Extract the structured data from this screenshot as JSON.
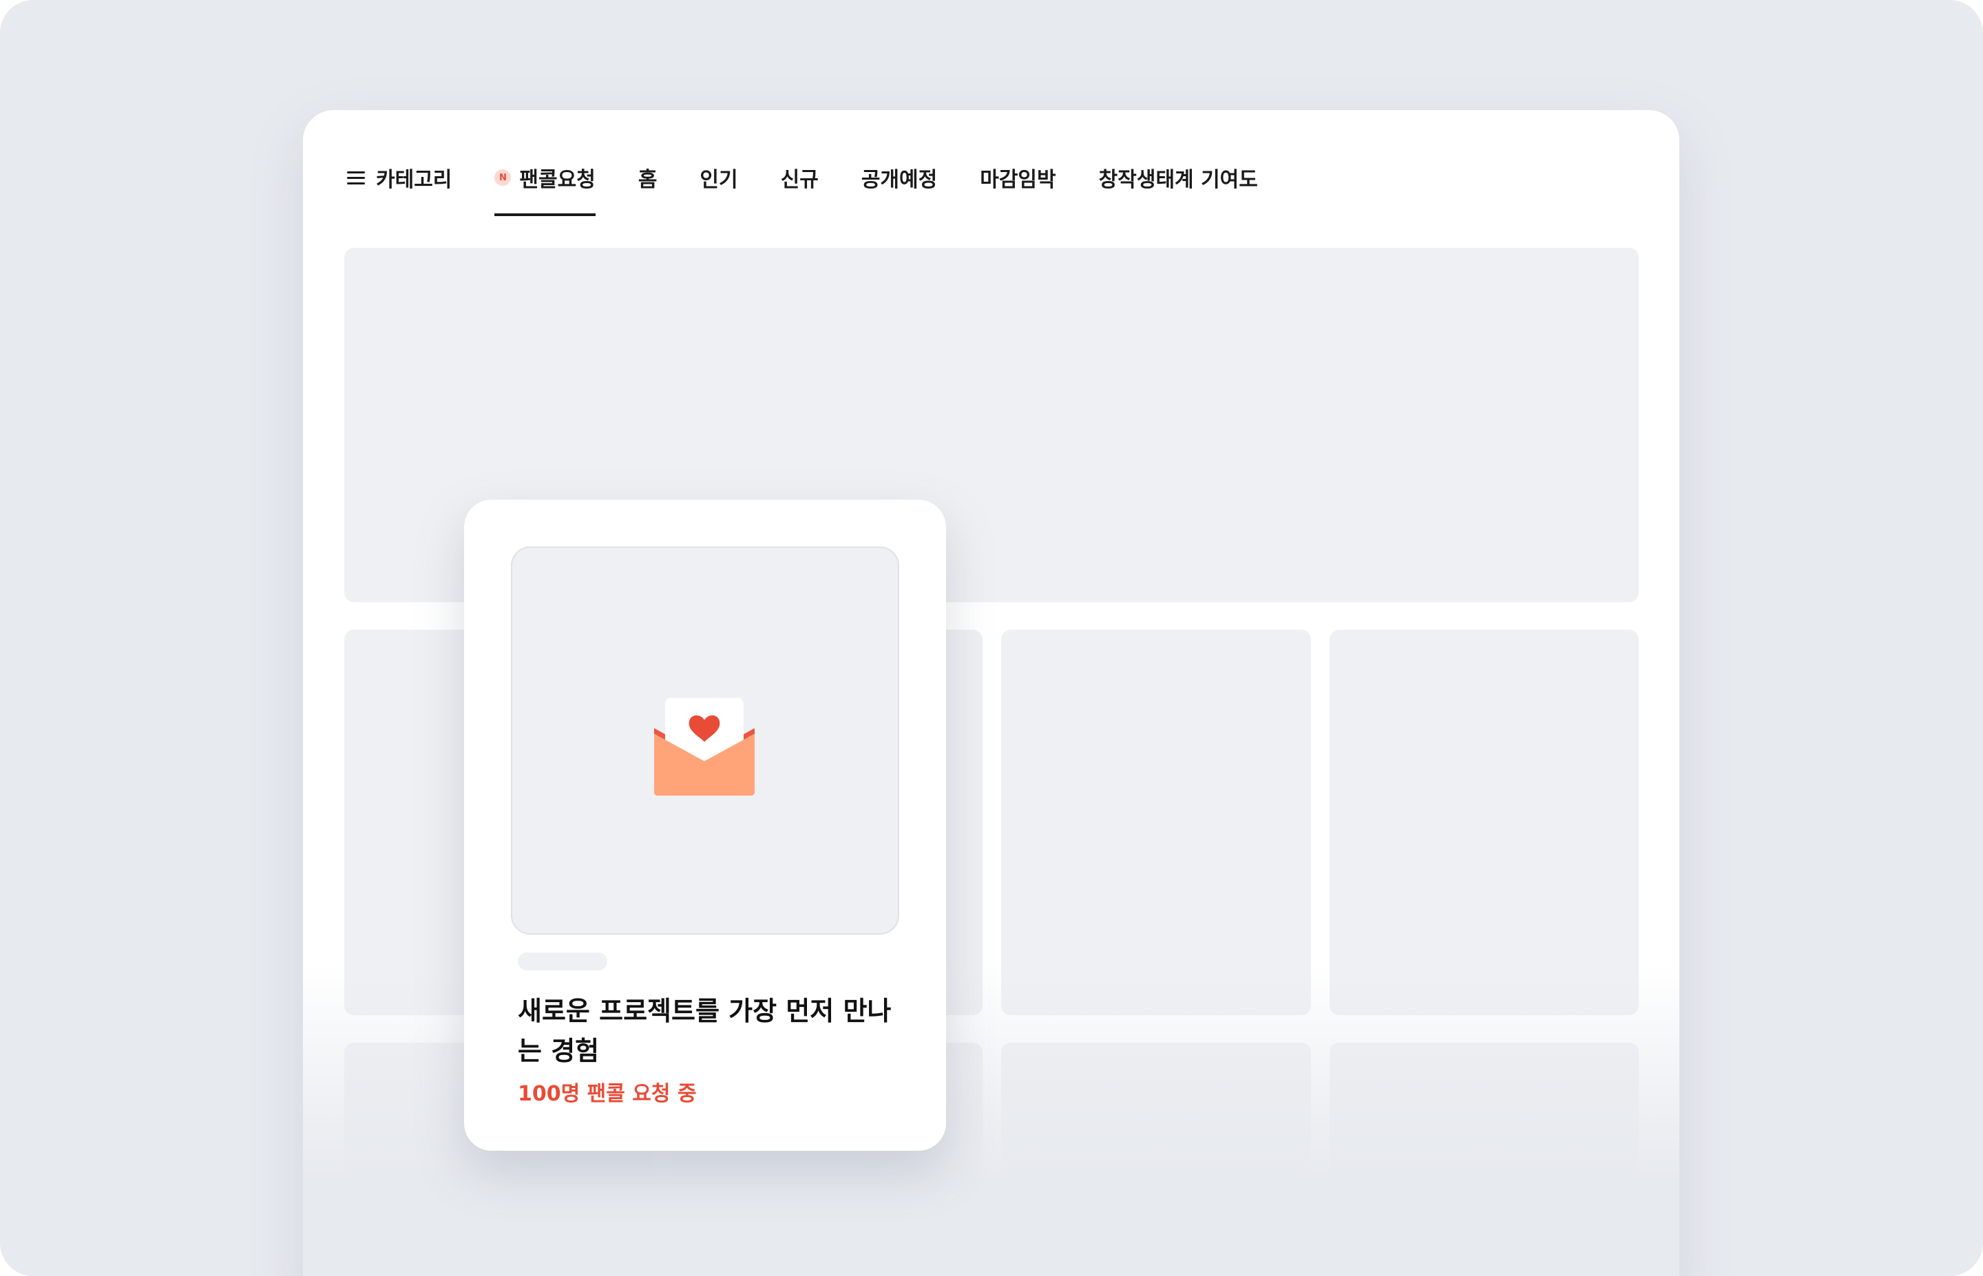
{
  "nav": {
    "items": [
      {
        "label": "카테고리"
      },
      {
        "label": "팬콜요청",
        "badge": "N"
      },
      {
        "label": "홈"
      },
      {
        "label": "인기"
      },
      {
        "label": "신규"
      },
      {
        "label": "공개예정"
      },
      {
        "label": "마감임박"
      },
      {
        "label": "창작생태계 기여도"
      }
    ],
    "active_index": 1
  },
  "card": {
    "icon": "envelope-heart-icon",
    "title": "새로운 프로젝트를 가장 먼저 만나는 경험",
    "subtitle": "100명 팬콜 요청 중"
  },
  "colors": {
    "accent": "#e84b36",
    "envelope": "#ffa478",
    "placeholder": "#eff0f3",
    "background": "#e7eaef"
  }
}
